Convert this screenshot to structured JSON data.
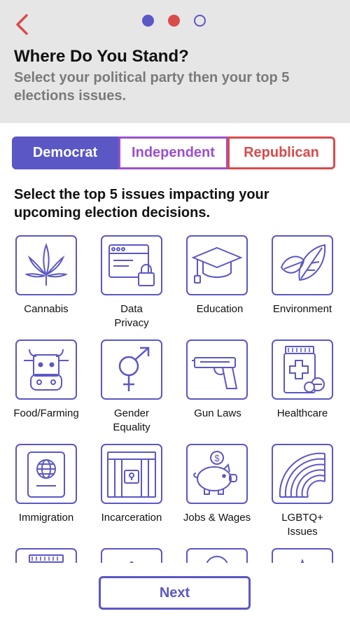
{
  "header": {
    "title": "Where Do You Stand?",
    "subtitle": "Select your political party then your top 5 elections issues.",
    "back_icon": "chevron-left-icon",
    "progress": {
      "total": 3,
      "current": 2
    }
  },
  "party": {
    "options": [
      "Democrat",
      "Independent",
      "Republican"
    ],
    "selected": "Democrat",
    "colors": {
      "democrat": "#5b57c5",
      "independent": "#9b4fd0",
      "republican": "#d94b4b"
    }
  },
  "issues": {
    "prompt": "Select the top 5 issues impacting your upcoming election decisions.",
    "items": [
      {
        "label": "Cannabis",
        "icon": "cannabis-leaf-icon"
      },
      {
        "label": "Data Privacy",
        "icon": "browser-lock-icon"
      },
      {
        "label": "Education",
        "icon": "graduation-cap-icon"
      },
      {
        "label": "Environment",
        "icon": "leaves-icon"
      },
      {
        "label": "Food/Farming",
        "icon": "cow-icon"
      },
      {
        "label": "Gender Equality",
        "icon": "gender-symbol-icon"
      },
      {
        "label": "Gun Laws",
        "icon": "pistol-icon"
      },
      {
        "label": "Healthcare",
        "icon": "medicine-bottle-icon"
      },
      {
        "label": "Immigration",
        "icon": "passport-icon"
      },
      {
        "label": "Incarceration",
        "icon": "jail-cell-icon"
      },
      {
        "label": "Jobs & Wages",
        "icon": "piggy-bank-icon"
      },
      {
        "label": "LGBTQ+ Issues",
        "icon": "rainbow-icon"
      }
    ]
  },
  "footer": {
    "next_label": "Next"
  },
  "accent": "#5b57c5"
}
